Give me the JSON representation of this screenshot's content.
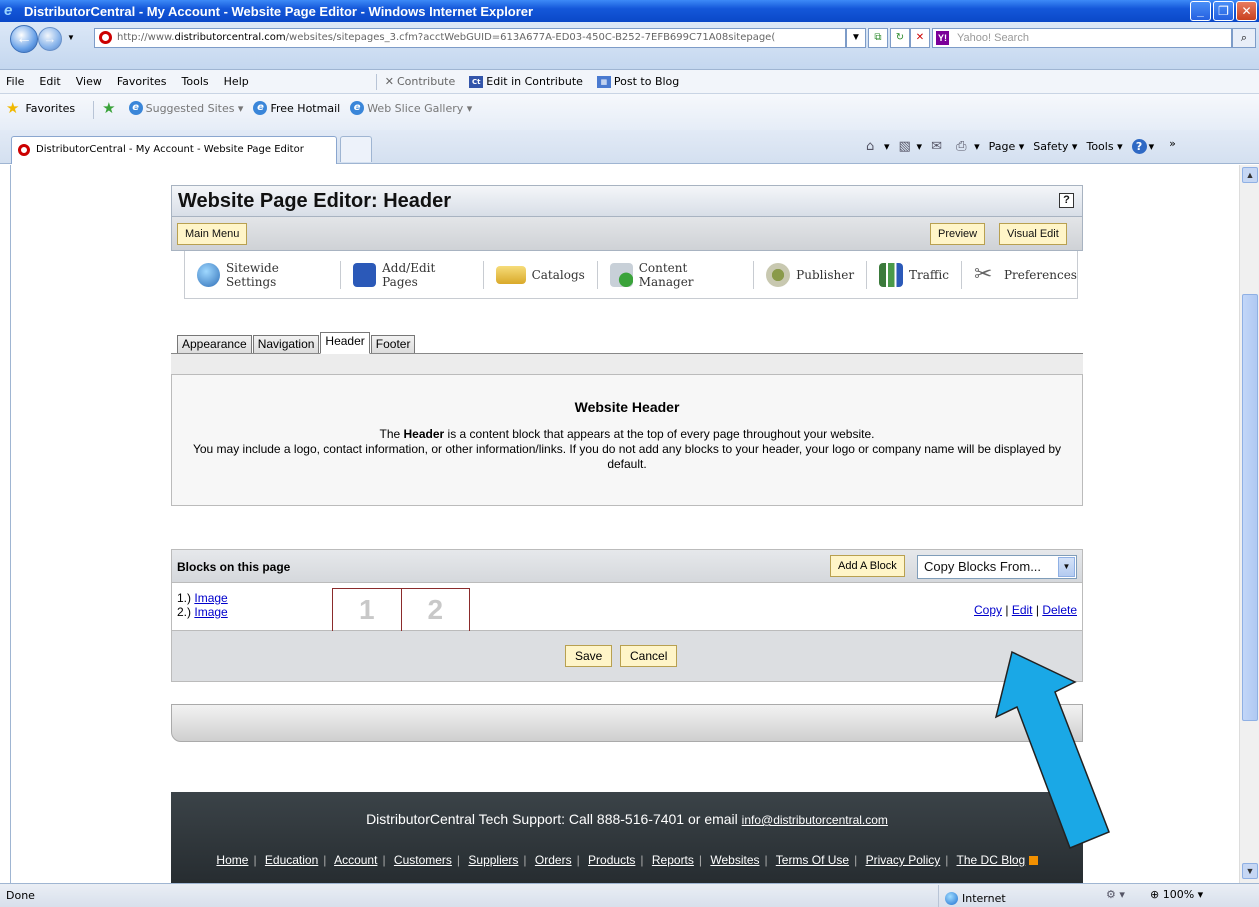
{
  "window": {
    "title": "DistributorCentral - My Account - Website Page Editor - Windows Internet Explorer",
    "buttons": {
      "minimize": "_",
      "maximize": "❐",
      "close": "✕"
    }
  },
  "address_bar": {
    "url_prefix": "http://www.",
    "url_domain": "distributorcentral.com",
    "url_rest": "/websites/sitepages_3.cfm?acctWebGUID=613A677A-ED03-450C-B252-7EFB699C71A08sitepage(",
    "search_placeholder": "Yahoo! Search",
    "search_logo": "Y!"
  },
  "menu": {
    "items": [
      "File",
      "Edit",
      "View",
      "Favorites",
      "Tools",
      "Help"
    ],
    "contribute": "Contribute",
    "edit_in_contribute": "Edit in Contribute",
    "post_to_blog": "Post to Blog",
    "contribute_icon_text": "Ct"
  },
  "favorites_bar": {
    "favorites": "Favorites",
    "suggested_sites": "Suggested Sites ▾",
    "free_hotmail": "Free Hotmail",
    "web_slice_gallery": "Web Slice Gallery ▾"
  },
  "browser_tab": {
    "label": "DistributorCentral - My Account - Website Page Editor"
  },
  "command_bar": {
    "page": "Page ▾",
    "safety": "Safety ▾",
    "tools": "Tools ▾",
    "help": "?",
    "more": "»"
  },
  "editor": {
    "title": "Website Page Editor: Header",
    "help_button": "?",
    "main_menu": "Main Menu",
    "preview": "Preview",
    "visual_edit": "Visual Edit",
    "tools": [
      {
        "label": "Sitewide Settings",
        "color": "#2f8a3c"
      },
      {
        "label": "Add/Edit Pages",
        "color": "#2b59b8"
      },
      {
        "label": "Catalogs",
        "color": "#e8c24a"
      },
      {
        "label": "Content Manager",
        "color": "#5a9a3a"
      },
      {
        "label": "Publisher",
        "color": "#8a9a4a"
      },
      {
        "label": "Traffic",
        "color": "#3b7a3b"
      },
      {
        "label": "Preferences",
        "color": "#777777"
      }
    ],
    "tabs": [
      "Appearance",
      "Navigation",
      "Header",
      "Footer"
    ],
    "active_tab": "Header",
    "info": {
      "heading": "Website Header",
      "line1_pre": "The ",
      "line1_bold": "Header",
      "line1_post": " is a content block that appears at the top of every page throughout your website.",
      "line2": "You may include a logo, contact information, or other information/links. If you do not add any blocks to your header, your logo or company name will be displayed by default."
    },
    "blocks": {
      "label": "Blocks on this page",
      "add_block": "Add A Block",
      "copy_from": "Copy Blocks From...",
      "items": [
        {
          "num": "1.)",
          "name": "Image"
        },
        {
          "num": "2.)",
          "name": "Image"
        }
      ],
      "thumbs": [
        "1",
        "2"
      ],
      "copy": "Copy",
      "edit": "Edit",
      "delete": "Delete",
      "save": "Save",
      "cancel": "Cancel"
    }
  },
  "footer": {
    "support_text": "DistributorCentral Tech Support: Call 888-516-7401 or email ",
    "support_email": "info@distributorcentral.com",
    "links": [
      "Home",
      "Education",
      "Account",
      "Customers",
      "Suppliers",
      "Orders",
      "Products",
      "Reports",
      "Websites",
      "Terms Of Use",
      "Privacy Policy",
      "The DC Blog"
    ]
  },
  "status_bar": {
    "status": "Done",
    "zone": "Internet",
    "zoom": "100%",
    "zoom_arrow": "▾"
  },
  "annotation": {
    "arrow_color": "#1aa8e6"
  }
}
